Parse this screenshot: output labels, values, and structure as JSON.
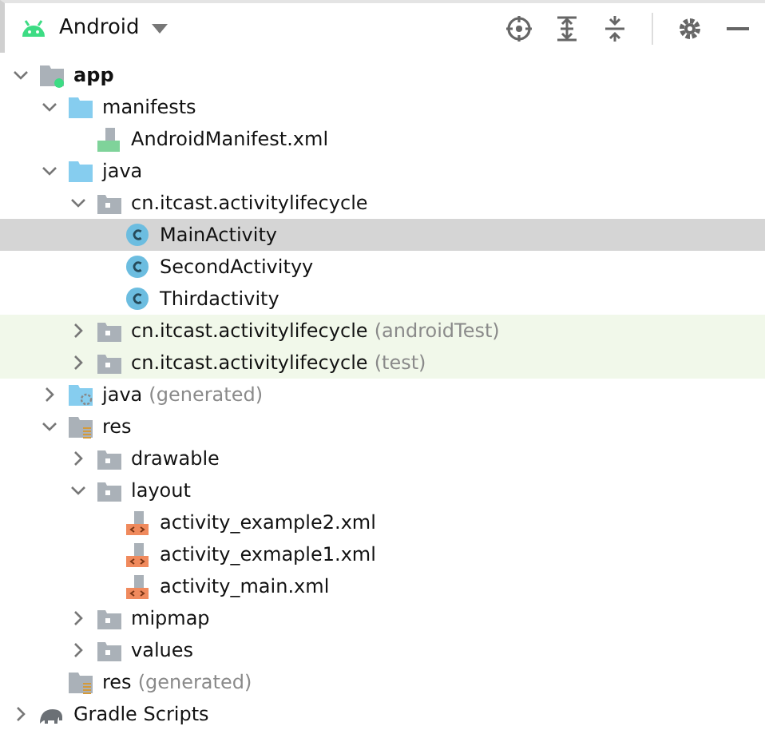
{
  "toolbar": {
    "view": "Android"
  },
  "tree": [
    {
      "label": "app",
      "kind": "module",
      "expanded": true,
      "selected": false,
      "tinted": false,
      "children": [
        {
          "label": "manifests",
          "kind": "folder",
          "expanded": true,
          "selected": false,
          "tinted": false,
          "children": [
            {
              "label": "AndroidManifest.xml",
              "kind": "manifest",
              "selected": false,
              "tinted": false
            }
          ]
        },
        {
          "label": "java",
          "kind": "folder",
          "expanded": true,
          "selected": false,
          "tinted": false,
          "children": [
            {
              "label": "cn.itcast.activitylifecycle",
              "kind": "package",
              "expanded": true,
              "selected": false,
              "tinted": false,
              "children": [
                {
                  "label": "MainActivity",
                  "kind": "class",
                  "selected": true,
                  "tinted": false
                },
                {
                  "label": "SecondActivityy",
                  "kind": "class",
                  "selected": false,
                  "tinted": false
                },
                {
                  "label": "Thirdactivity",
                  "kind": "class",
                  "selected": false,
                  "tinted": false
                }
              ]
            },
            {
              "label": "cn.itcast.activitylifecycle",
              "suffix": "(androidTest)",
              "kind": "package",
              "expanded": false,
              "selected": false,
              "tinted": true
            },
            {
              "label": "cn.itcast.activitylifecycle",
              "suffix": "(test)",
              "kind": "package",
              "expanded": false,
              "selected": false,
              "tinted": true
            }
          ]
        },
        {
          "label": "java",
          "suffix": "(generated)",
          "kind": "generated-folder",
          "expanded": false,
          "selected": false,
          "tinted": false
        },
        {
          "label": "res",
          "kind": "res-folder",
          "expanded": true,
          "selected": false,
          "tinted": false,
          "children": [
            {
              "label": "drawable",
              "kind": "package",
              "expanded": false,
              "selected": false,
              "tinted": false
            },
            {
              "label": "layout",
              "kind": "package",
              "expanded": true,
              "selected": false,
              "tinted": false,
              "children": [
                {
                  "label": "activity_example2.xml",
                  "kind": "layout-xml",
                  "selected": false,
                  "tinted": false
                },
                {
                  "label": "activity_exmaple1.xml",
                  "kind": "layout-xml",
                  "selected": false,
                  "tinted": false
                },
                {
                  "label": "activity_main.xml",
                  "kind": "layout-xml",
                  "selected": false,
                  "tinted": false
                }
              ]
            },
            {
              "label": "mipmap",
              "kind": "package",
              "expanded": false,
              "selected": false,
              "tinted": false
            },
            {
              "label": "values",
              "kind": "package",
              "expanded": false,
              "selected": false,
              "tinted": false
            }
          ]
        },
        {
          "label": "res",
          "suffix": "(generated)",
          "kind": "res-folder",
          "selected": false,
          "tinted": false
        }
      ]
    },
    {
      "label": "Gradle Scripts",
      "kind": "gradle",
      "expanded": false,
      "selected": false,
      "tinted": false
    }
  ]
}
